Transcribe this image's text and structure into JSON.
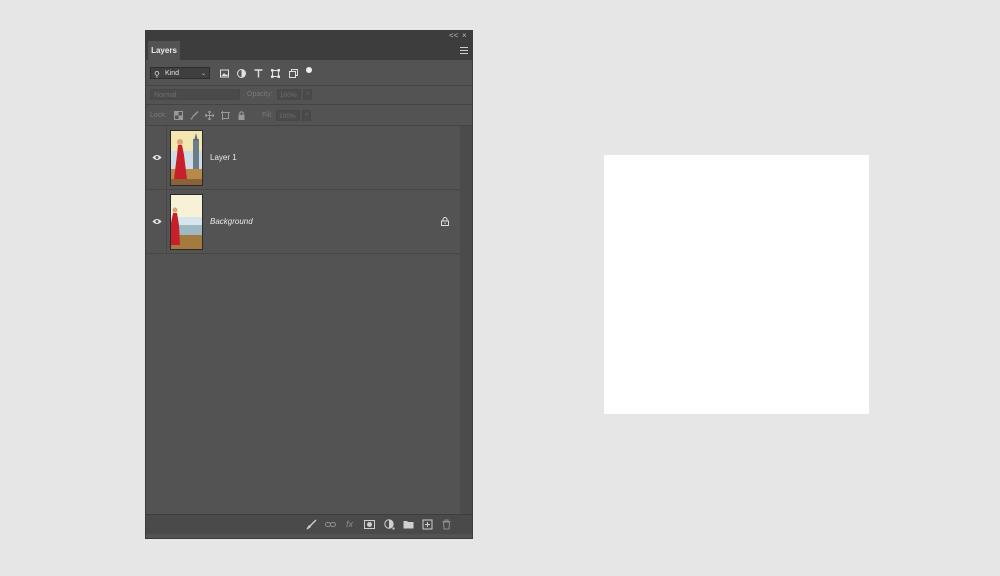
{
  "panel": {
    "collapse_label": "<<",
    "close_label": "×",
    "tab_label": "Layers"
  },
  "filter": {
    "kind_label": "Kind",
    "icons": [
      "image-filter-icon",
      "adjustment-filter-icon",
      "type-filter-icon",
      "shape-filter-icon",
      "smart-object-filter-icon",
      "filter-toggle-icon"
    ]
  },
  "blend": {
    "mode": "Normal",
    "opacity_label": "Opacity:",
    "opacity_value": "100%"
  },
  "lock": {
    "label": "Lock:",
    "icons": [
      "lock-transparent-icon",
      "lock-paint-icon",
      "lock-position-icon",
      "lock-artboard-icon",
      "lock-all-icon"
    ],
    "fill_label": "Fill:",
    "fill_value": "100%"
  },
  "layers": [
    {
      "name": "Layer 1",
      "visible": true,
      "locked": false
    },
    {
      "name": "Background",
      "visible": true,
      "locked": true
    }
  ],
  "bottom_icons": [
    "brush-icon",
    "link-icon",
    "fx-icon",
    "mask-icon",
    "adjustment-icon",
    "folder-icon",
    "new-layer-icon",
    "trash-icon"
  ],
  "fx_label": "fx",
  "colors": {
    "panel_bg": "#535353",
    "workspace_bg": "#e6e6e6",
    "canvas_bg": "#ffffff",
    "dress_red": "#c8202a"
  }
}
